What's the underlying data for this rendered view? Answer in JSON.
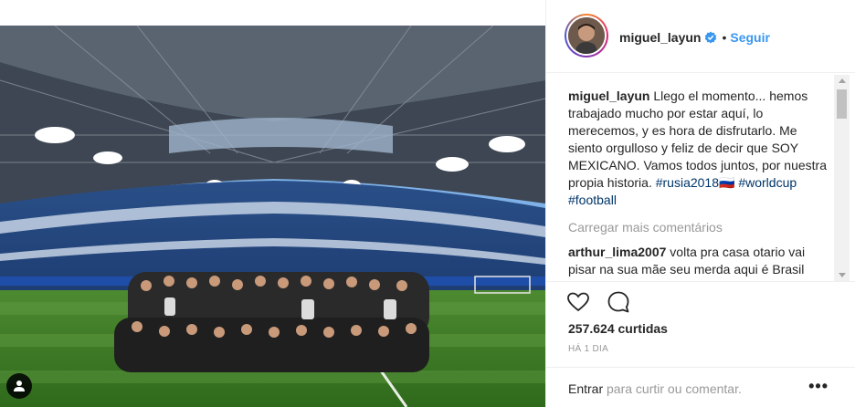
{
  "post": {
    "username": "miguel_layun",
    "follow_label": "Seguir",
    "separator": "•"
  },
  "caption": {
    "username": "miguel_layun",
    "text": "Llego el momento... hemos trabajado mucho por estar aquí, lo merecemos, y es hora de disfrutarlo. Me siento orgulloso y feliz de decir que SOY MEXICANO. Vamos todos juntos, por nuestra propia historia.",
    "hashtag_1": "#rusia2018🇷🇺",
    "hashtag_2": "#worldcup",
    "hashtag_3": "#football"
  },
  "comments": {
    "load_more": "Carregar mais comentários",
    "items": [
      {
        "username": "arthur_lima2007",
        "text": "volta pra casa otario vai pisar na sua mãe seu merda aqui é Brasil caralho se fudeu seu escroto"
      }
    ]
  },
  "stats": {
    "likes": "257.624 curtidas",
    "time_ago": "HÁ 1 DIA"
  },
  "comment_box": {
    "login_link": "Entrar",
    "login_suffix": " para curtir ou comentar.",
    "more_dots": "•••"
  },
  "icons": {
    "like": "heart-icon",
    "comment": "comment-icon",
    "verified": "verified-badge-icon",
    "tag": "user-tag-icon"
  },
  "colors": {
    "link_blue": "#3897f0",
    "hashtag": "#003569",
    "muted": "#999999",
    "text": "#262626"
  }
}
